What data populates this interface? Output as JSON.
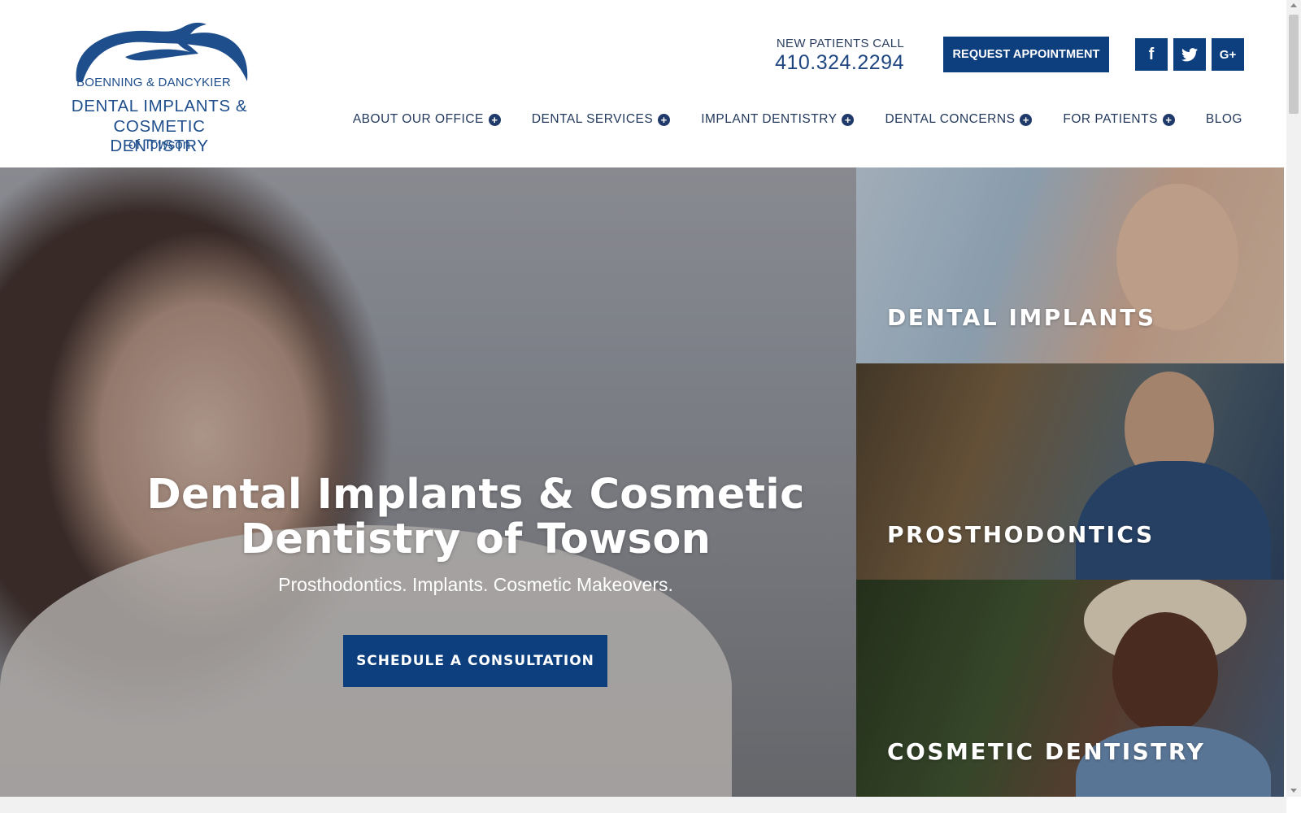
{
  "logo": {
    "line1": "BOENNING & DANCYKIER",
    "line2": "DENTAL IMPLANTS &",
    "line3": "COSMETIC DENTISTRY",
    "line4": "of Towson"
  },
  "header": {
    "call_label": "NEW PATIENTS CALL",
    "phone": "410.324.2294",
    "request_button": "REQUEST APPOINTMENT",
    "social": [
      {
        "icon": "facebook-icon",
        "glyph": "f"
      },
      {
        "icon": "twitter-icon",
        "glyph": "🐦"
      },
      {
        "icon": "google-plus-icon",
        "glyph": "G+"
      }
    ]
  },
  "nav": {
    "items": [
      {
        "label": "ABOUT OUR OFFICE",
        "has_submenu": true
      },
      {
        "label": "DENTAL SERVICES",
        "has_submenu": true
      },
      {
        "label": "IMPLANT DENTISTRY",
        "has_submenu": true
      },
      {
        "label": "DENTAL CONCERNS",
        "has_submenu": true
      },
      {
        "label": "FOR PATIENTS",
        "has_submenu": true
      },
      {
        "label": "BLOG",
        "has_submenu": false
      }
    ],
    "plus_glyph": "+"
  },
  "hero": {
    "title_line1": "Dental Implants & Cosmetic",
    "title_line2": "Dentistry of Towson",
    "subtitle": "Prosthodontics. Implants. Cosmetic Makeovers.",
    "cta": "SCHEDULE A CONSULTATION"
  },
  "tiles": [
    {
      "label": "DENTAL IMPLANTS"
    },
    {
      "label": "PROSTHODONTICS"
    },
    {
      "label": "COSMETIC DENTISTRY"
    }
  ],
  "colors": {
    "brand_blue": "#0d3f7f",
    "text_navy": "#23395d"
  }
}
